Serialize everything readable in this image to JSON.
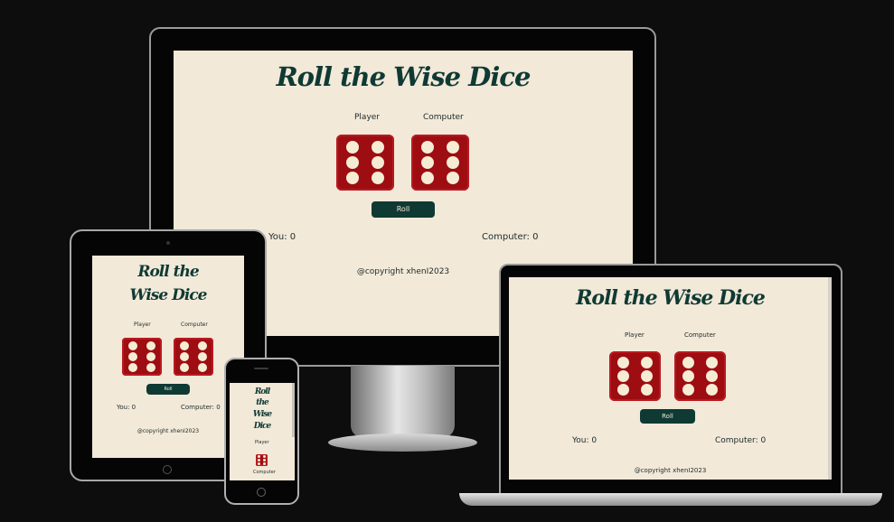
{
  "app": {
    "title": "Roll the Wise Dice",
    "title_line1": "Roll the",
    "title_line2": "Wise Dice",
    "mobile_title_lines": [
      "Roll",
      "the",
      "Wise",
      "Dice"
    ],
    "player_label": "Player",
    "computer_label": "Computer",
    "roll_button": "Roll",
    "player_score": "You: 0",
    "computer_score": "Computer: 0",
    "footer": "@copyright xhenI2023",
    "player_die_face": 6,
    "computer_die_face": 6
  },
  "colors": {
    "background": "#0e0d0e",
    "page": "#f2e9d9",
    "accent": "#0f3a33",
    "die": "#9d0d12",
    "pip": "#f5ecd3"
  }
}
